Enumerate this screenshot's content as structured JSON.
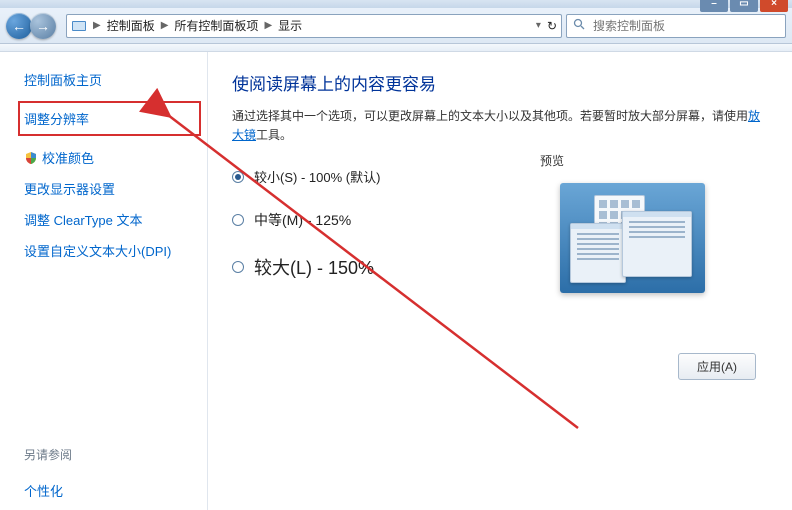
{
  "window_buttons": {
    "min": "–",
    "max": "▭",
    "close": "×"
  },
  "nav": {
    "back": "←",
    "forward": "→",
    "refresh": "↻"
  },
  "breadcrumb": {
    "sep": "▶",
    "items": [
      "控制面板",
      "所有控制面板项",
      "显示"
    ]
  },
  "search": {
    "placeholder": "搜索控制面板"
  },
  "sidebar": {
    "home": "控制面板主页",
    "items": [
      "调整分辨率",
      "校准颜色",
      "更改显示器设置",
      "调整 ClearType 文本",
      "设置自定义文本大小(DPI)"
    ],
    "see_also_label": "另请参阅",
    "see_also_items": [
      "个性化"
    ]
  },
  "main": {
    "title": "使阅读屏幕上的内容更容易",
    "desc_prefix": "通过选择其中一个选项，可以更改屏幕上的文本大小以及其他项。若要暂时放大部分屏幕，请使用",
    "desc_link": "放大镜",
    "desc_suffix": "工具。",
    "options": [
      {
        "label": "较小(S) - 100% (默认)",
        "checked": true
      },
      {
        "label": "中等(M) - 125%",
        "checked": false
      },
      {
        "label": "较大(L) - 150%",
        "checked": false
      }
    ],
    "preview_label": "预览",
    "apply": "应用(A)"
  }
}
